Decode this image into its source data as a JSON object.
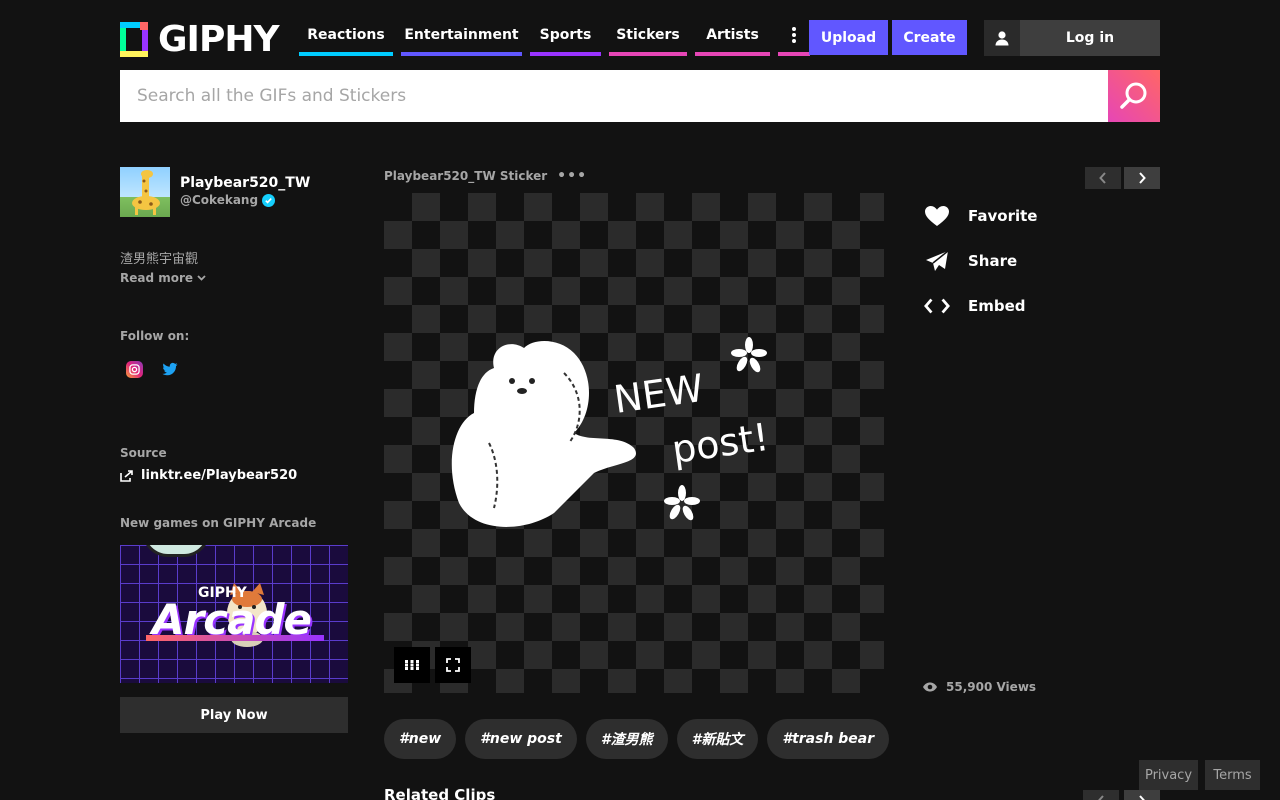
{
  "header": {
    "logo_text": "GIPHY",
    "nav": [
      {
        "label": "Reactions",
        "color": "#00ccff"
      },
      {
        "label": "Entertainment",
        "color": "#6157ff"
      },
      {
        "label": "Sports",
        "color": "#9933ff"
      },
      {
        "label": "Stickers",
        "color": "#e646b6"
      },
      {
        "label": "Artists",
        "color": "#e646b6"
      },
      {
        "label": "",
        "color": "#e646b6"
      }
    ],
    "upload_label": "Upload",
    "create_label": "Create",
    "login_label": "Log in",
    "accent_color": "#6157ff"
  },
  "search": {
    "placeholder": "Search all the GIFs and Stickers",
    "value": ""
  },
  "channel": {
    "name": "Playbear520_TW",
    "handle": "@Cokekang",
    "bio": "渣男熊宇宙觀",
    "read_more": "Read more",
    "follow_label": "Follow on:",
    "source_label": "Source",
    "source_link": "linktr.ee/Playbear520",
    "arcade_label": "New games on GIPHY Arcade",
    "arcade_brand": "GIPHY",
    "arcade_title": "Arcade",
    "play_now": "Play Now"
  },
  "gif": {
    "title": "Playbear520_TW Sticker",
    "more": "•••"
  },
  "actions": {
    "favorite": "Favorite",
    "share": "Share",
    "embed": "Embed",
    "views": "55,900 Views"
  },
  "tags": [
    "#new",
    "#new post",
    "#渣男熊",
    "#新貼文",
    "#trash bear"
  ],
  "related_title": "Related Clips",
  "footer": {
    "privacy": "Privacy",
    "terms": "Terms"
  }
}
